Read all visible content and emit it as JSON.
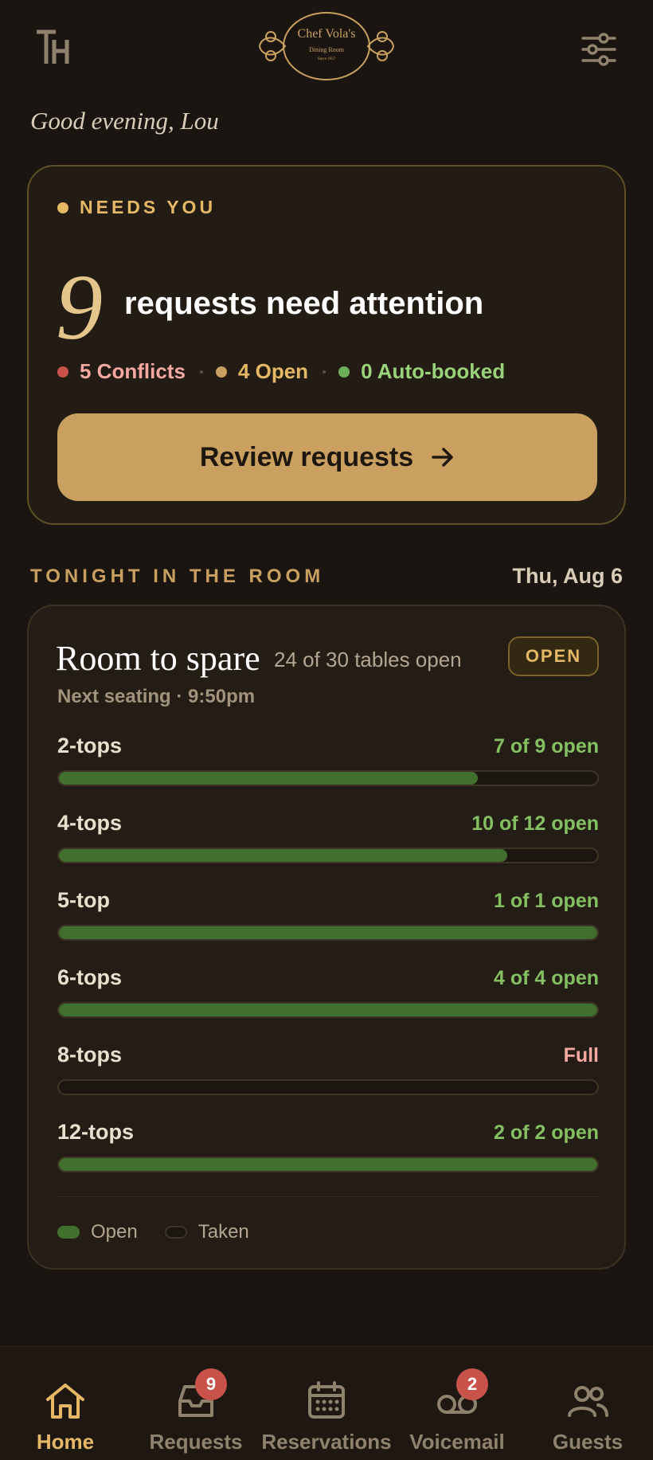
{
  "colors": {
    "background": "#1a1510",
    "accent": "#c9a060",
    "open_green": "#416f2e",
    "status_green": "#84c062",
    "conflict_red": "#c9534a",
    "full_pink": "#f4a8a0"
  },
  "header": {
    "left_logo_icon": "th-monogram-icon",
    "brand": {
      "line1": "Chef Vola's",
      "line2": "Dining Room",
      "line3": "Since 1957"
    },
    "filter_icon": "sliders-icon"
  },
  "greeting": "Good evening, Lou",
  "needs_you": {
    "label": "NEEDS YOU",
    "count": "9",
    "headline": "requests need attention",
    "stats": [
      {
        "label": "5 Conflicts",
        "color": "#c9534a",
        "text_color": "#f4a8a0"
      },
      {
        "label": "4 Open",
        "color": "#c9a060",
        "text_color": "#e5b866"
      },
      {
        "label": "0 Auto-booked",
        "color": "#6fae58",
        "text_color": "#9ad27a"
      }
    ],
    "button_label": "Review requests",
    "button_icon": "arrow-right-icon"
  },
  "tonight": {
    "section_title": "TONIGHT IN THE ROOM",
    "date": "Thu, Aug 6",
    "room_title": "Room to spare",
    "room_summary": "24 of 30 tables open",
    "badge": "OPEN",
    "next_seating": "Next seating · 9:50pm",
    "tiers": [
      {
        "name": "2-tops",
        "status": "7 of 9 open",
        "open": 7,
        "total": 9,
        "status_color": "#84c062"
      },
      {
        "name": "4-tops",
        "status": "10 of 12 open",
        "open": 10,
        "total": 12,
        "status_color": "#84c062"
      },
      {
        "name": "5-top",
        "status": "1 of 1 open",
        "open": 1,
        "total": 1,
        "status_color": "#84c062"
      },
      {
        "name": "6-tops",
        "status": "4 of 4 open",
        "open": 4,
        "total": 4,
        "status_color": "#84c062"
      },
      {
        "name": "8-tops",
        "status": "Full",
        "open": 0,
        "total": 1,
        "status_color": "#f4a8a0"
      },
      {
        "name": "12-tops",
        "status": "2 of 2 open",
        "open": 2,
        "total": 2,
        "status_color": "#84c062"
      }
    ],
    "legend": {
      "open": "Open",
      "taken": "Taken"
    }
  },
  "nav": [
    {
      "label": "Home",
      "icon": "home-icon",
      "active": true,
      "badge": ""
    },
    {
      "label": "Requests",
      "icon": "inbox-icon",
      "active": false,
      "badge": "9"
    },
    {
      "label": "Reservations",
      "icon": "calendar-icon",
      "active": false,
      "badge": ""
    },
    {
      "label": "Voicemail",
      "icon": "voicemail-icon",
      "active": false,
      "badge": "2"
    },
    {
      "label": "Guests",
      "icon": "users-icon",
      "active": false,
      "badge": ""
    }
  ]
}
